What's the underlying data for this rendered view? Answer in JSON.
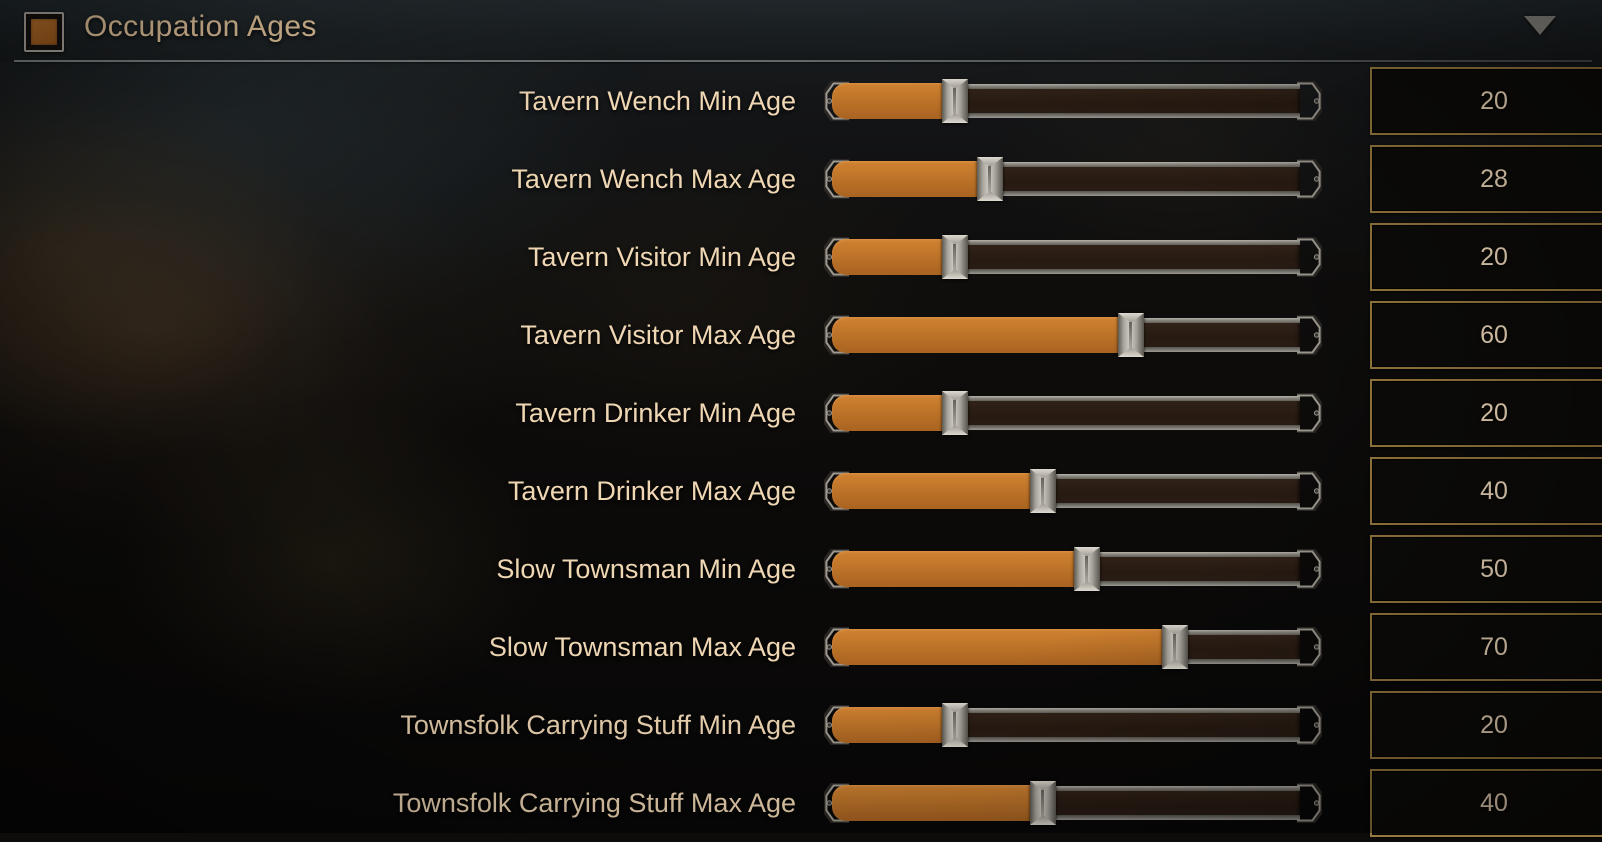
{
  "header": {
    "title": "Occupation Ages",
    "checkbox_checked": true,
    "collapse_icon": "chevron-down-icon",
    "accent_color": "#c87b2e",
    "title_color": "#f0cfa4"
  },
  "theme": {
    "label_color": "#f0d7b4",
    "value_border_color": "#97793d",
    "value_text_color": "#f3dcbd",
    "slider_fill_color": "#c0762a",
    "track_color": "#2e2016"
  },
  "slider_range": {
    "min": 0,
    "max": 100
  },
  "rows": [
    {
      "label": "Tavern Wench Min Age",
      "value": "20",
      "percent": 20
    },
    {
      "label": "Tavern Wench Max Age",
      "value": "28",
      "percent": 28
    },
    {
      "label": "Tavern Visitor Min Age",
      "value": "20",
      "percent": 20
    },
    {
      "label": "Tavern Visitor Max Age",
      "value": "60",
      "percent": 60
    },
    {
      "label": "Tavern Drinker Min Age",
      "value": "20",
      "percent": 20
    },
    {
      "label": "Tavern Drinker Max Age",
      "value": "40",
      "percent": 40
    },
    {
      "label": "Slow Townsman Min Age",
      "value": "50",
      "percent": 50
    },
    {
      "label": "Slow Townsman Max Age",
      "value": "70",
      "percent": 70
    },
    {
      "label": "Townsfolk Carrying Stuff Min Age",
      "value": "20",
      "percent": 20
    },
    {
      "label": "Townsfolk Carrying Stuff Max Age",
      "value": "40",
      "percent": 40
    }
  ]
}
